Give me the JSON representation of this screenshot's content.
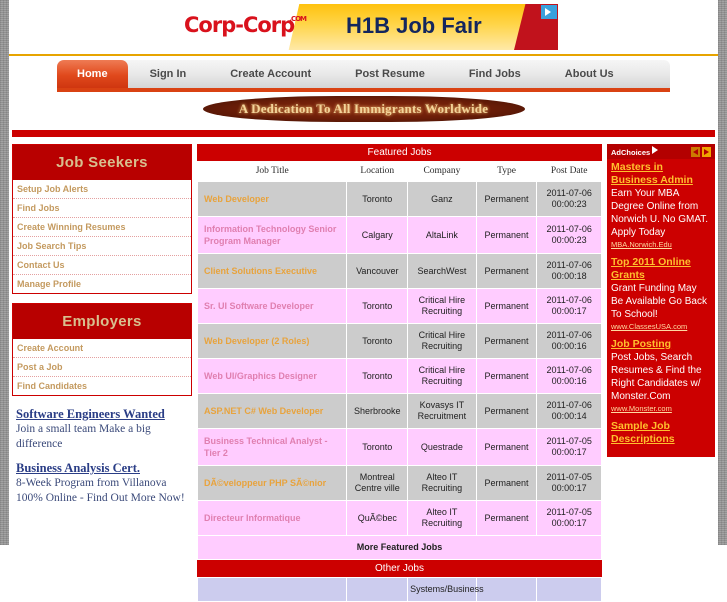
{
  "header": {
    "logo_text": "Corp-Corp",
    "logo_suffix": ".COM",
    "banner_title": "H1B Job Fair",
    "ad_arrow_icon": "ad-choices-triangle-icon"
  },
  "nav": {
    "items": [
      {
        "label": "Home",
        "active": true
      },
      {
        "label": "Sign In",
        "active": false
      },
      {
        "label": "Create Account",
        "active": false
      },
      {
        "label": "Post Resume",
        "active": false
      },
      {
        "label": "Find Jobs",
        "active": false
      },
      {
        "label": "About Us",
        "active": false
      }
    ]
  },
  "tagline": {
    "text": "A Dedication To All Immigrants Worldwide"
  },
  "sidebar_left": {
    "panels": [
      {
        "title": "Job Seekers",
        "links": [
          "Setup Job Alerts",
          "Find Jobs",
          "Create Winning Resumes",
          "Job Search Tips",
          "Contact Us",
          "Manage Profile"
        ]
      },
      {
        "title": "Employers",
        "links": [
          "Create Account",
          "Post a Job",
          "Find Candidates"
        ]
      }
    ],
    "ads": [
      {
        "title": "Software Engineers Wanted",
        "body": "Join a small team Make a big difference"
      },
      {
        "title": "Business Analysis Cert.",
        "body": "8-Week Program from Villanova 100% Online - Find Out More Now!"
      }
    ]
  },
  "main": {
    "featured_heading": "Featured Jobs",
    "other_heading": "Other Jobs",
    "more_link": "More Featured Jobs",
    "columns": [
      "Job Title",
      "Location",
      "Company",
      "Type",
      "Post Date"
    ],
    "rows": [
      {
        "title": "Web Developer",
        "location": "Toronto",
        "company": "Ganz",
        "type": "Permanent",
        "date": "2011-07-06 00:00:23",
        "shade": "r-gray"
      },
      {
        "title": "Information Technology Senior Program Manager",
        "location": "Calgary",
        "company": "AltaLink",
        "type": "Permanent",
        "date": "2011-07-06 00:00:23",
        "shade": "r-pink"
      },
      {
        "title": "Client Solutions Executive",
        "location": "Vancouver",
        "company": "SearchWest",
        "type": "Permanent",
        "date": "2011-07-06 00:00:18",
        "shade": "r-gray"
      },
      {
        "title": "Sr. UI Software Developer",
        "location": "Toronto",
        "company": "Critical Hire Recruiting",
        "type": "Permanent",
        "date": "2011-07-06 00:00:17",
        "shade": "r-pink"
      },
      {
        "title": "Web Developer (2 Roles)",
        "location": "Toronto",
        "company": "Critical Hire Recruiting",
        "type": "Permanent",
        "date": "2011-07-06 00:00:16",
        "shade": "r-gray"
      },
      {
        "title": "Web UI/Graphics Designer",
        "location": "Toronto",
        "company": "Critical Hire Recruiting",
        "type": "Permanent",
        "date": "2011-07-06 00:00:16",
        "shade": "r-pink"
      },
      {
        "title": "ASP.NET C# Web Developer",
        "location": "Sherbrooke",
        "company": "Kovasys IT Recruitment",
        "type": "Permanent",
        "date": "2011-07-06 00:00:14",
        "shade": "r-gray"
      },
      {
        "title": "Business Technical Analyst - Tier 2",
        "location": "Toronto",
        "company": "Questrade",
        "type": "Permanent",
        "date": "2011-07-05 00:00:17",
        "shade": "r-pink"
      },
      {
        "title": "DÃ©veloppeur PHP SÃ©nior",
        "location": "Montreal Centre ville",
        "company": "Alteo IT Recruiting",
        "type": "Permanent",
        "date": "2011-07-05 00:00:17",
        "shade": "r-gray"
      },
      {
        "title": "Directeur Informatique",
        "location": "QuÃ©bec",
        "company": "Alteo IT Recruiting",
        "type": "Permanent",
        "date": "2011-07-05 00:00:17",
        "shade": "r-pink"
      }
    ],
    "other_rows": [
      {
        "title": "",
        "location": "",
        "company": "Systems/Business",
        "type": "",
        "date": "",
        "shade": "r-lav"
      }
    ]
  },
  "sidebar_right": {
    "adchoices_label": "AdChoices",
    "prev_icon": "chevron-left-icon",
    "next_icon": "chevron-right-icon",
    "info_icon": "adchoices-triangle-icon",
    "ads": [
      {
        "title": "Masters in Business Admin",
        "body": "Earn Your MBA Degree Online from Norwich U. No GMAT. Apply Today",
        "url": "MBA.Norwich.Edu"
      },
      {
        "title": "Top 2011 Online Grants",
        "body": "Grant Funding May Be Available Go Back To School!",
        "url": "www.ClassesUSA.com"
      },
      {
        "title": "Job Posting",
        "body": "Post Jobs, Search Resumes & Find the Right Candidates w/ Monster.Com",
        "url": "www.Monster.com"
      },
      {
        "title": "Sample Job Descriptions",
        "body": "",
        "url": ""
      }
    ]
  }
}
